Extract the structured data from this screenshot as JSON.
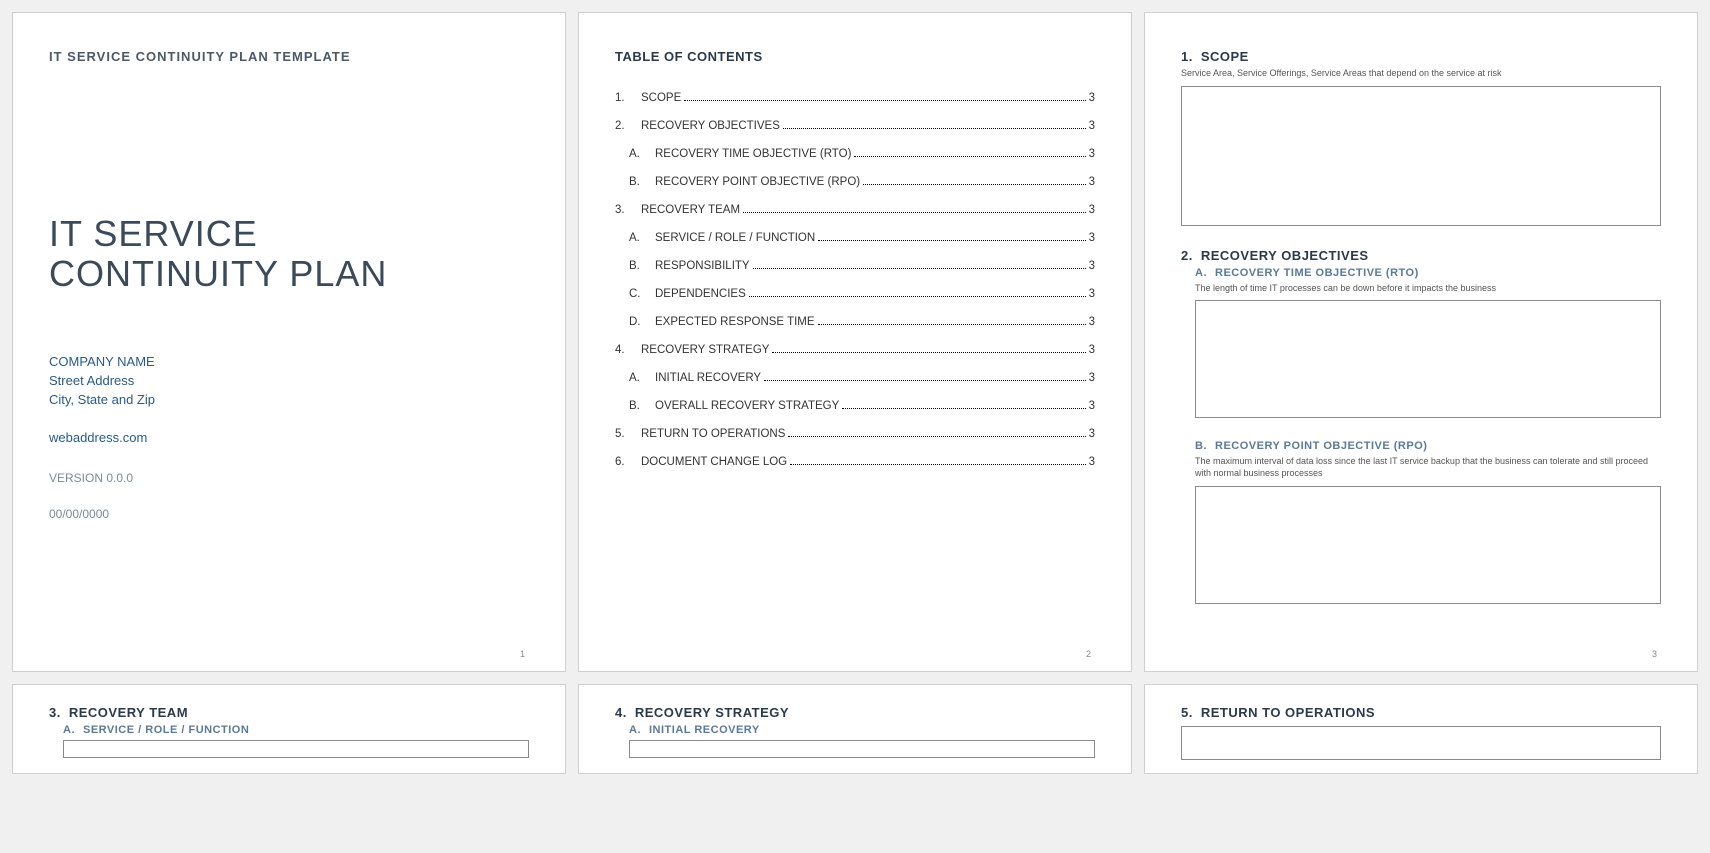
{
  "page1": {
    "template_label": "IT SERVICE CONTINUITY PLAN TEMPLATE",
    "title_line1": "IT SERVICE",
    "title_line2": "CONTINUITY PLAN",
    "company_name": "COMPANY NAME",
    "street": "Street Address",
    "city": "City, State and Zip",
    "web": "webaddress.com",
    "version": "VERSION 0.0.0",
    "date": "00/00/0000",
    "page_num": "1"
  },
  "toc": {
    "heading": "TABLE OF CONTENTS",
    "page_num": "2",
    "items": [
      {
        "num": "1.",
        "label": "SCOPE",
        "page": "3",
        "sub": false
      },
      {
        "num": "2.",
        "label": "RECOVERY OBJECTIVES",
        "page": "3",
        "sub": false
      },
      {
        "num": "A.",
        "label": "RECOVERY TIME OBJECTIVE (RTO)",
        "page": "3",
        "sub": true
      },
      {
        "num": "B.",
        "label": "RECOVERY POINT OBJECTIVE (RPO)",
        "page": "3",
        "sub": true
      },
      {
        "num": "3.",
        "label": "RECOVERY TEAM",
        "page": "3",
        "sub": false
      },
      {
        "num": "A.",
        "label": "SERVICE / ROLE / FUNCTION",
        "page": "3",
        "sub": true
      },
      {
        "num": "B.",
        "label": "RESPONSIBILITY",
        "page": "3",
        "sub": true
      },
      {
        "num": "C.",
        "label": "DEPENDENCIES",
        "page": "3",
        "sub": true
      },
      {
        "num": "D.",
        "label": "EXPECTED RESPONSE TIME",
        "page": "3",
        "sub": true
      },
      {
        "num": "4.",
        "label": "RECOVERY STRATEGY",
        "page": "3",
        "sub": false
      },
      {
        "num": "A.",
        "label": "INITIAL RECOVERY",
        "page": "3",
        "sub": true
      },
      {
        "num": "B.",
        "label": "OVERALL RECOVERY STRATEGY",
        "page": "3",
        "sub": true
      },
      {
        "num": "5.",
        "label": "RETURN TO OPERATIONS",
        "page": "3",
        "sub": false
      },
      {
        "num": "6.",
        "label": "DOCUMENT CHANGE LOG",
        "page": "3",
        "sub": false
      }
    ]
  },
  "page3": {
    "page_num": "3",
    "s1_num": "1.",
    "s1_title": "SCOPE",
    "s1_desc": "Service Area, Service Offerings, Service Areas that depend on the service at risk",
    "s2_num": "2.",
    "s2_title": "RECOVERY OBJECTIVES",
    "s2a_num": "A.",
    "s2a_title": "RECOVERY TIME OBJECTIVE (RTO)",
    "s2a_desc": "The length of time IT processes can be down before it impacts the business",
    "s2b_num": "B.",
    "s2b_title": "RECOVERY POINT OBJECTIVE (RPO)",
    "s2b_desc": "The maximum interval of data loss since the last IT service backup that the business can tolerate and still proceed with normal business processes"
  },
  "page4": {
    "s3_num": "3.",
    "s3_title": "RECOVERY TEAM",
    "s3a_num": "A.",
    "s3a_title": "SERVICE / ROLE / FUNCTION"
  },
  "page5": {
    "s4_num": "4.",
    "s4_title": "RECOVERY STRATEGY",
    "s4a_num": "A.",
    "s4a_title": "INITIAL RECOVERY"
  },
  "page6": {
    "s5_num": "5.",
    "s5_title": "RETURN TO OPERATIONS"
  }
}
